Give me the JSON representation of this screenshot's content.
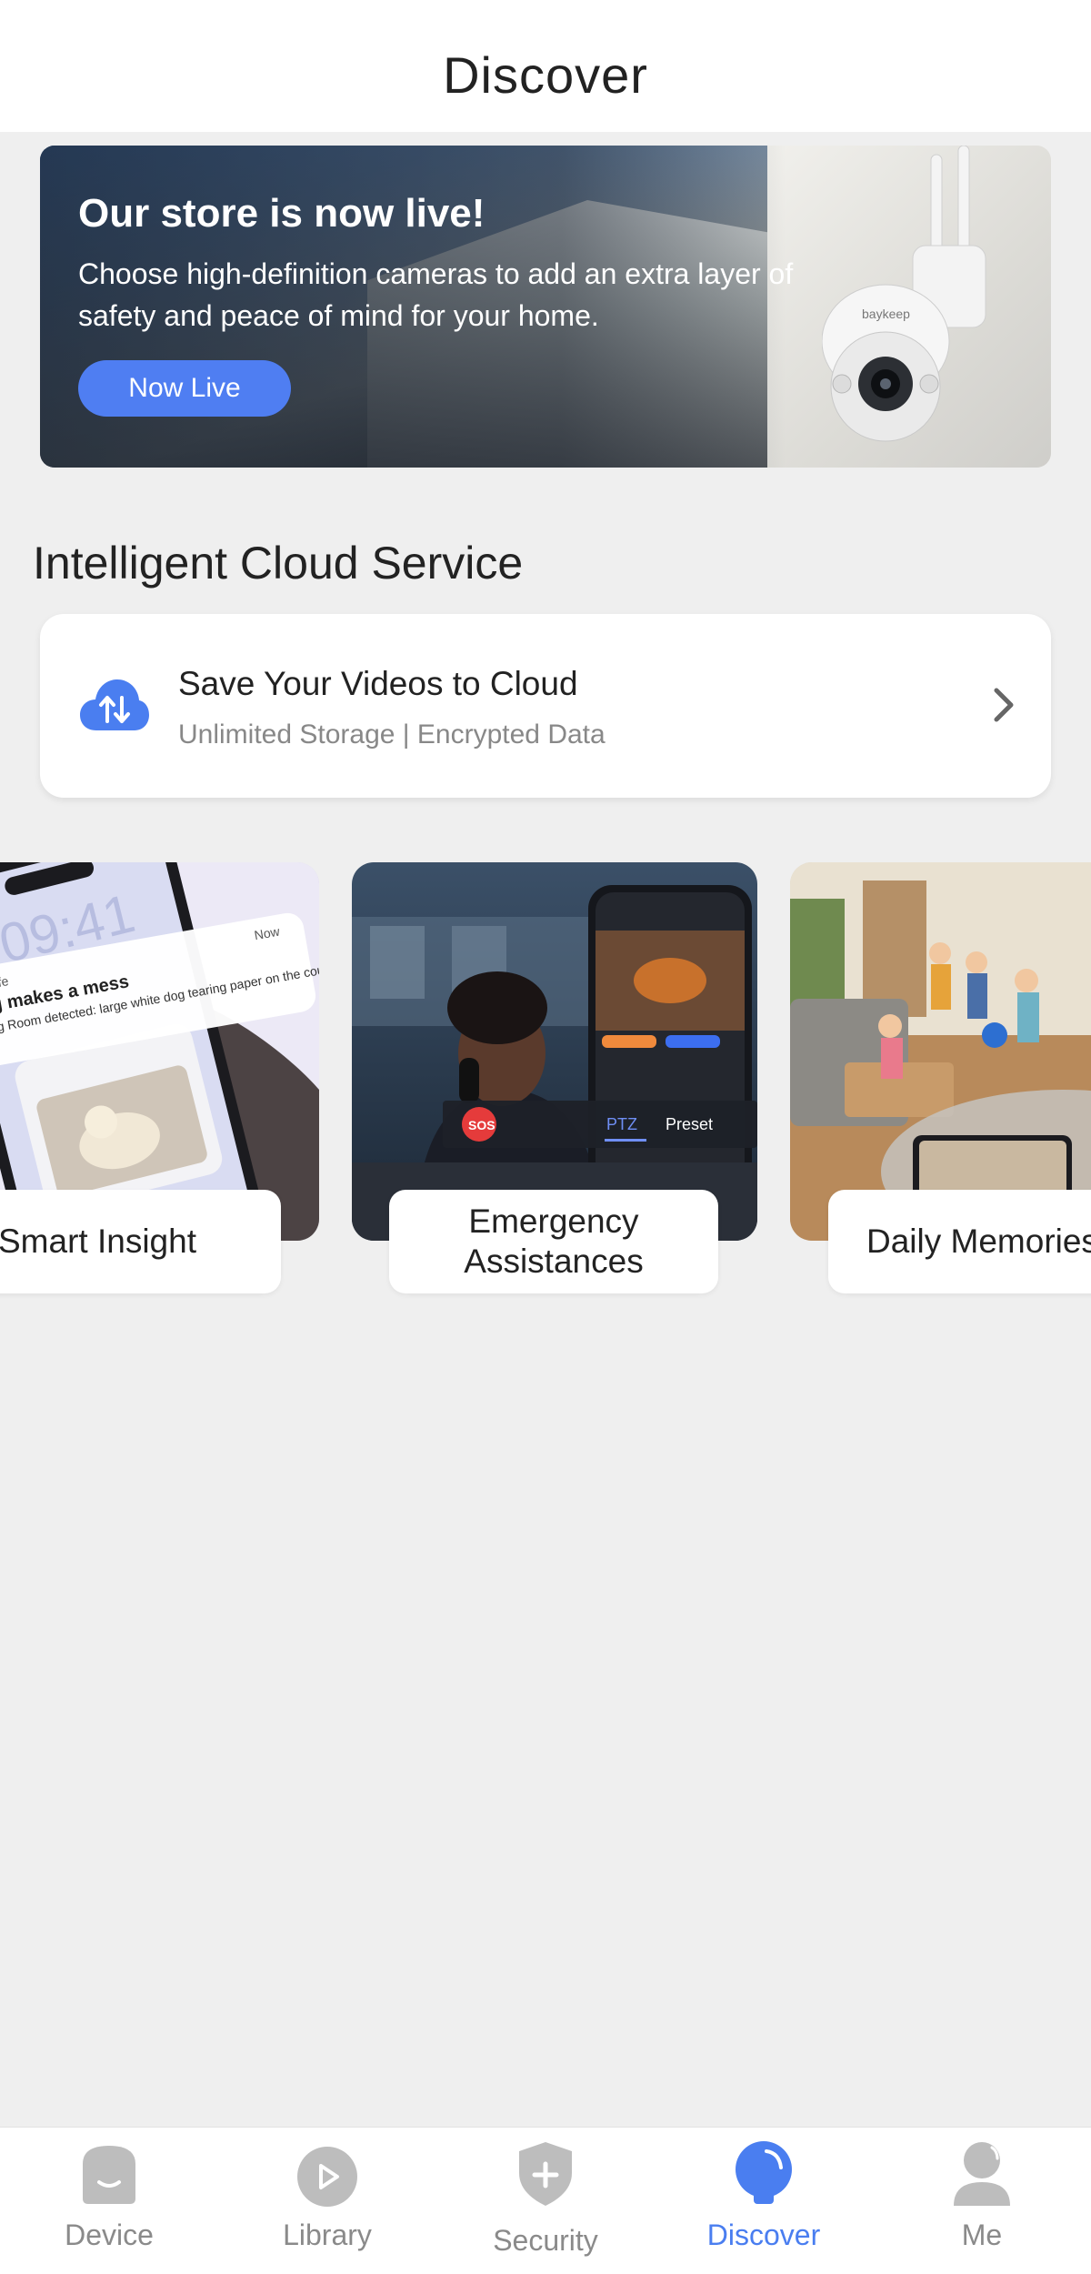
{
  "header": {
    "title": "Discover"
  },
  "banner": {
    "title": "Our store is now live!",
    "subtitle": "Choose high-definition cameras to add an extra layer of safety and peace of mind for your home.",
    "button": "Now Live",
    "camera_brand": "baykeep"
  },
  "cloud_section": {
    "title": "Intelligent Cloud Service",
    "card_title": "Save Your Videos to Cloud",
    "card_subtitle": "Unlimited Storage | Encrypted Data"
  },
  "features": [
    {
      "label": "Smart Insight",
      "image": "phone-notification-dog"
    },
    {
      "label": "Emergency Assistances",
      "image": "operator-with-sos-phone"
    },
    {
      "label": "Daily Memories",
      "image": "kids-playing-living-room"
    }
  ],
  "feature_texts": {
    "notif_now": "Now",
    "notif_app": "Easelife",
    "notif_title": "Dog makes a mess",
    "notif_body": "Living Room detected: large white dog tearing paper on the couch",
    "sos": "SOS",
    "ptz": "PTZ",
    "preset": "Preset"
  },
  "tabs": [
    {
      "label": "Device",
      "icon": "device-icon",
      "active": false
    },
    {
      "label": "Library",
      "icon": "library-play-icon",
      "active": false
    },
    {
      "label": "Security",
      "icon": "security-shield-icon",
      "active": false
    },
    {
      "label": "Discover",
      "icon": "discover-bulb-icon",
      "active": true
    },
    {
      "label": "Me",
      "icon": "me-person-icon",
      "active": false
    }
  ],
  "colors": {
    "accent": "#4a7ef0",
    "banner_button": "#4f7ef2",
    "background": "#efefef"
  }
}
